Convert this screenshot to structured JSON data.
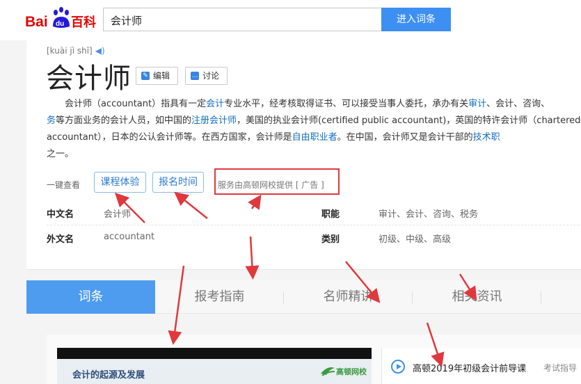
{
  "header": {
    "logo_text": "Bai百科",
    "logo_du": "du",
    "search_value": "会计师",
    "search_button": "进入词条"
  },
  "entry": {
    "pinyin": "[kuài jì shī]",
    "title": "会计师",
    "edit_label": "编辑",
    "discuss_label": "讨论",
    "summary": [
      {
        "t": "会计师（accountant）指具有一定",
        "link": false
      },
      {
        "t": "会计",
        "link": true
      },
      {
        "t": "专业水平，经考核取得证书、可以接受当事人委托，承办有关",
        "link": false
      },
      {
        "t": "审计",
        "link": true
      },
      {
        "t": "、会计、咨询、",
        "link": false
      },
      {
        "t": "务",
        "link": true
      },
      {
        "t": "等方面业务的会计人员，如中国的",
        "link": false
      },
      {
        "t": "注册会计师",
        "link": true
      },
      {
        "t": "，美国的执业会计师(certified public accountant)，英国的特许会计师（chartered accountant），日本的公认会计师等。在西方国家，会计师是",
        "link": false
      },
      {
        "t": "自由职业者",
        "link": true
      },
      {
        "t": "。在中国，会计师又是会计干部的",
        "link": false
      },
      {
        "t": "技术职",
        "link": true
      },
      {
        "t": "之一。",
        "link": false
      }
    ]
  },
  "quick": {
    "label": "一键查看",
    "btn1": "课程体验",
    "btn2": "报名时间",
    "ad": "服务由高顿网校提供 [ 广告 ]"
  },
  "info": {
    "r1_label_a": "中文名",
    "r1_value_a": "会计师",
    "r1_label_b": "职能",
    "r1_value_b": "审计、会计、咨询、税务",
    "r2_label_a": "外文名",
    "r2_value_a": "accountant",
    "r2_label_b": "类别",
    "r2_value_b": "初级、中级、高级"
  },
  "tabs": [
    "词条",
    "报考指南",
    "名师精讲",
    "相关资讯"
  ],
  "lower": {
    "video_title": "会计的起源及发展",
    "video_logo": "高顿网校",
    "playlist_title": "高顿2019年初级会计前导课",
    "playlist_meta": "考试指导"
  },
  "colors": {
    "accent": "#3e8ff2",
    "link": "#136ec2",
    "annotation_red": "#e0383d"
  }
}
